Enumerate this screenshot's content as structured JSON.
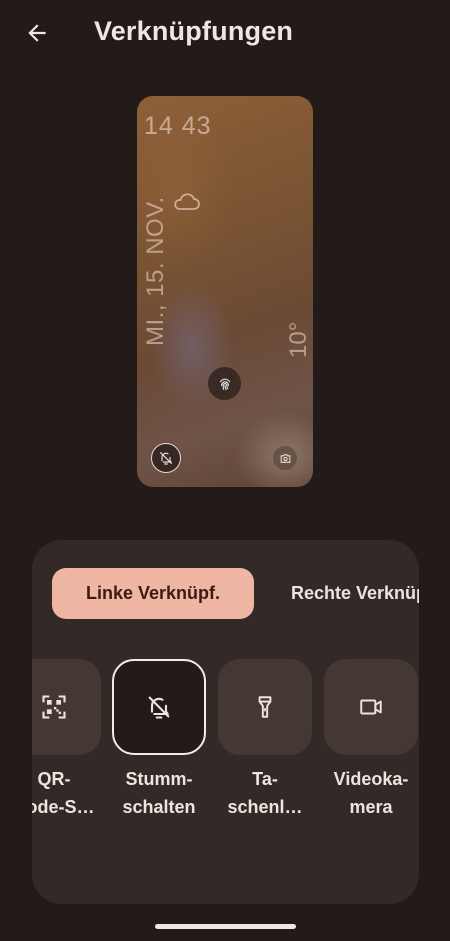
{
  "header": {
    "title": "Verknüpfungen",
    "back_icon": "arrow-left-icon"
  },
  "preview": {
    "time": "14 43",
    "date": "MI., 15. NOV.",
    "temperature": "10°",
    "weather_icon": "cloud-icon",
    "center_icon": "fingerprint-icon",
    "left_shortcut_icon": "bell-off-icon",
    "right_shortcut_icon": "camera-icon"
  },
  "tabs": {
    "left": "Linke Verknüpf.",
    "right": "Rechte Verknüpf."
  },
  "shortcuts": [
    {
      "label_line1": "QR-",
      "label_line2": "Code-S…",
      "icon": "qr-code-icon",
      "selected": false
    },
    {
      "label_line1": "Stumm-",
      "label_line2": "schalten",
      "icon": "bell-off-icon",
      "selected": true
    },
    {
      "label_line1": "Ta-",
      "label_line2": "schenl…",
      "icon": "flashlight-icon",
      "selected": false
    },
    {
      "label_line1": "Videoka-",
      "label_line2": "mera",
      "icon": "video-camera-icon",
      "selected": false
    }
  ],
  "colors": {
    "background": "#231b19",
    "panel": "#332a27",
    "tile": "#433834",
    "accent": "#efb6a3",
    "text": "#efe3df"
  }
}
